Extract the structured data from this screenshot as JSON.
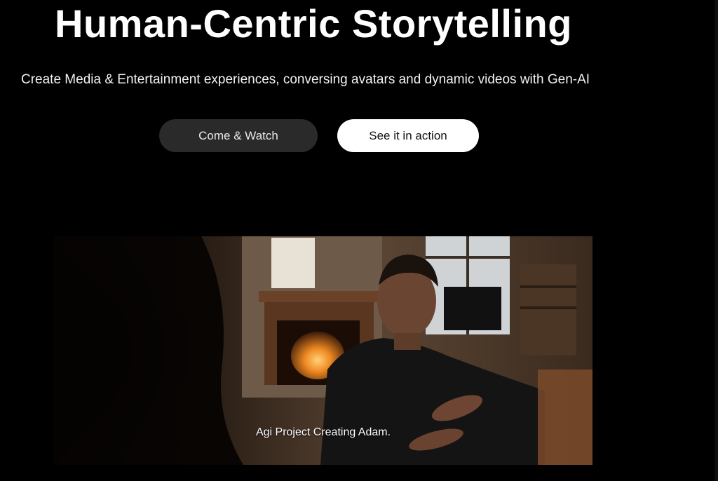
{
  "hero": {
    "title": "Human-Centric Storytelling",
    "subtitle": "Create Media & Entertainment experiences, conversing avatars and dynamic videos with Gen-AI"
  },
  "buttons": {
    "primary_label": "Come & Watch",
    "secondary_label": "See it in action"
  },
  "video": {
    "caption": "Agi Project Creating Adam."
  },
  "colors": {
    "background": "#000000",
    "dark_button": "#2a2a2a",
    "light_button": "#ffffff"
  }
}
